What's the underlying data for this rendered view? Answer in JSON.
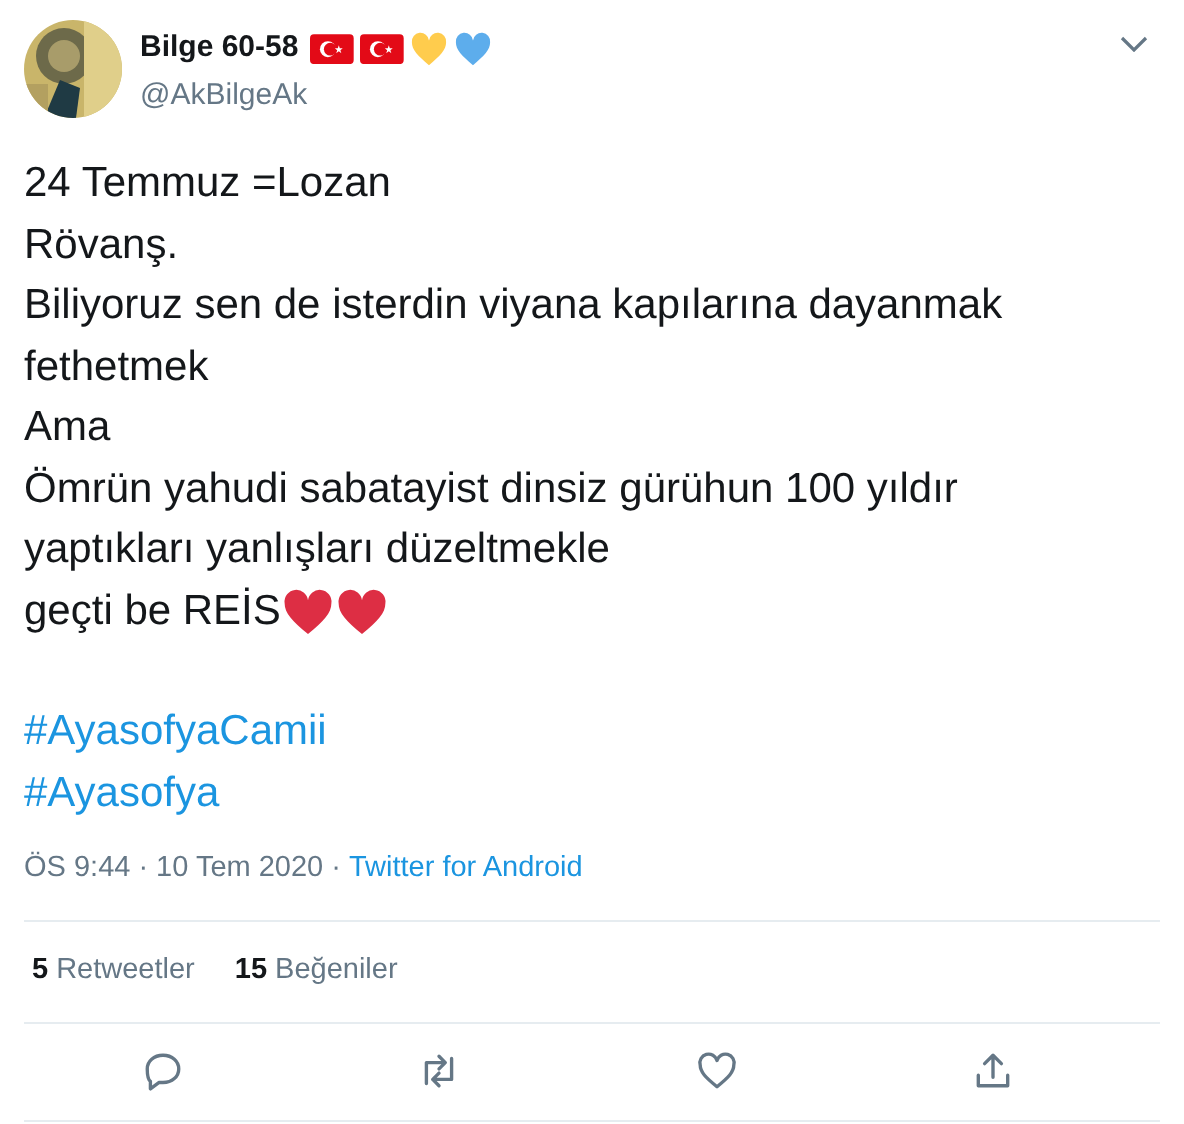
{
  "author": {
    "name": "Bilge 60-58",
    "handle": "@AkBilgeAk"
  },
  "name_emoji": [
    {
      "kind": "flag",
      "color": "#e30a17"
    },
    {
      "kind": "flag",
      "color": "#e30a17"
    },
    {
      "kind": "heart",
      "color": "#ffcc4d"
    },
    {
      "kind": "heart",
      "color": "#5dadec"
    }
  ],
  "body_lines": [
    {
      "text": "24 Temmuz =Lozan"
    },
    {
      "text": "Rövanş."
    },
    {
      "text": "Biliyoruz sen de isterdin viyana kapılarına dayanmak"
    },
    {
      "text": "fethetmek"
    },
    {
      "text": "Ama"
    },
    {
      "text": "Ömrün yahudi sabatayist dinsiz gürühun 100 yıldır"
    },
    {
      "text": "yaptıkları yanlışları düzeltmekle"
    },
    {
      "text": "geçti be REİS",
      "emoji": [
        {
          "kind": "heart",
          "color": "#dd2e44"
        },
        {
          "kind": "heart",
          "color": "#dd2e44"
        }
      ]
    }
  ],
  "hashtags": [
    "#AyasofyaCamii",
    "#Ayasofya"
  ],
  "meta": {
    "time": "ÖS 9:44",
    "separator_1": "·",
    "date": "10 Tem 2020",
    "separator_2": "·",
    "source": "Twitter for Android"
  },
  "stats": [
    {
      "count": "5",
      "label": "Retweetler"
    },
    {
      "count": "15",
      "label": "Beğeniler"
    }
  ],
  "actions": [
    {
      "kind": "reply"
    },
    {
      "kind": "retweet"
    },
    {
      "kind": "like"
    },
    {
      "kind": "share"
    }
  ]
}
